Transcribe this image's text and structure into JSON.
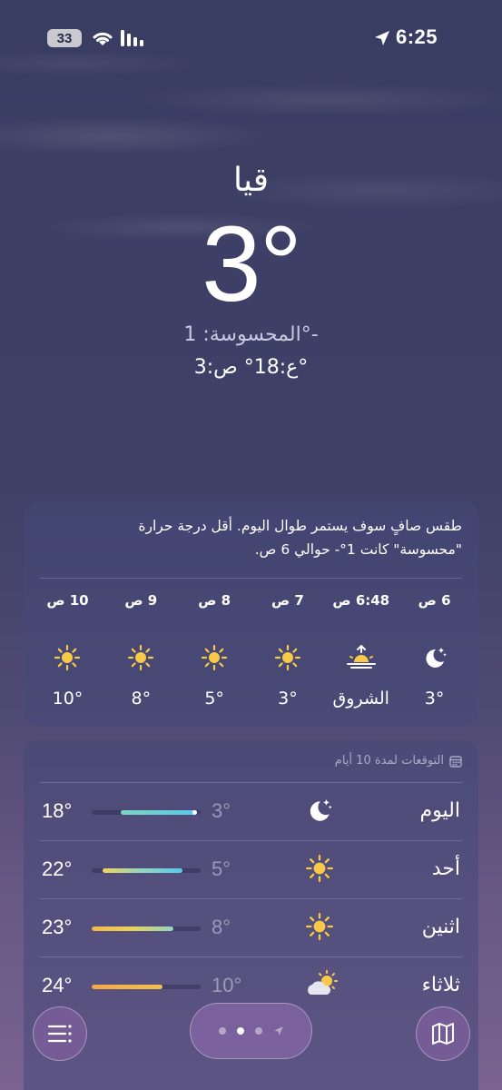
{
  "status": {
    "battery": "33",
    "time": "6:25"
  },
  "header": {
    "city": "قيا",
    "temp": "3°",
    "feels_like": "المحسوسة: 1°-",
    "high_low": "ع:18° ص:3°"
  },
  "hourly": {
    "summary": "طقس صافٍ سوف يستمر طوال اليوم. أقل درجة حرارة \"محسوسة\" كانت 1°- حوالي 6 ص.",
    "hours": [
      {
        "label": "6 ص",
        "icon": "moon-stars-icon",
        "temp": "3°"
      },
      {
        "label": "6:48 ص",
        "icon": "sunrise-icon",
        "temp": "الشروق"
      },
      {
        "label": "7 ص",
        "icon": "sun-icon",
        "temp": "3°"
      },
      {
        "label": "8 ص",
        "icon": "sun-icon",
        "temp": "5°"
      },
      {
        "label": "9 ص",
        "icon": "sun-icon",
        "temp": "8°"
      },
      {
        "label": "10 ص",
        "icon": "sun-icon",
        "temp": "10°"
      }
    ]
  },
  "daily": {
    "header": "التوقعات لمدة 10 أيام",
    "days": [
      {
        "name": "اليوم",
        "icon": "moon-stars-icon",
        "low": "3°",
        "high": "18°",
        "range_start": 0.27,
        "range_end": 0.97,
        "current": true
      },
      {
        "name": "أحد",
        "icon": "sun-icon",
        "low": "5°",
        "high": "22°",
        "range_start": 0.1,
        "range_end": 0.83,
        "current": false
      },
      {
        "name": "اثنين",
        "icon": "sun-icon",
        "low": "8°",
        "high": "23°",
        "range_start": 0.0,
        "range_end": 0.75,
        "current": false
      },
      {
        "name": "ثلاثاء",
        "icon": "partly-cloudy-icon",
        "low": "10°",
        "high": "24°",
        "range_start": 0.0,
        "range_end": 0.65,
        "current": false
      }
    ]
  },
  "colors": {
    "accent": "#ffffff",
    "sun": "#f7c948",
    "bar_cool": "#7ed3c4",
    "bar_warm": "#f2c14e"
  },
  "bottom_bar": {
    "list_icon": "list-icon",
    "map_icon": "map-icon"
  }
}
